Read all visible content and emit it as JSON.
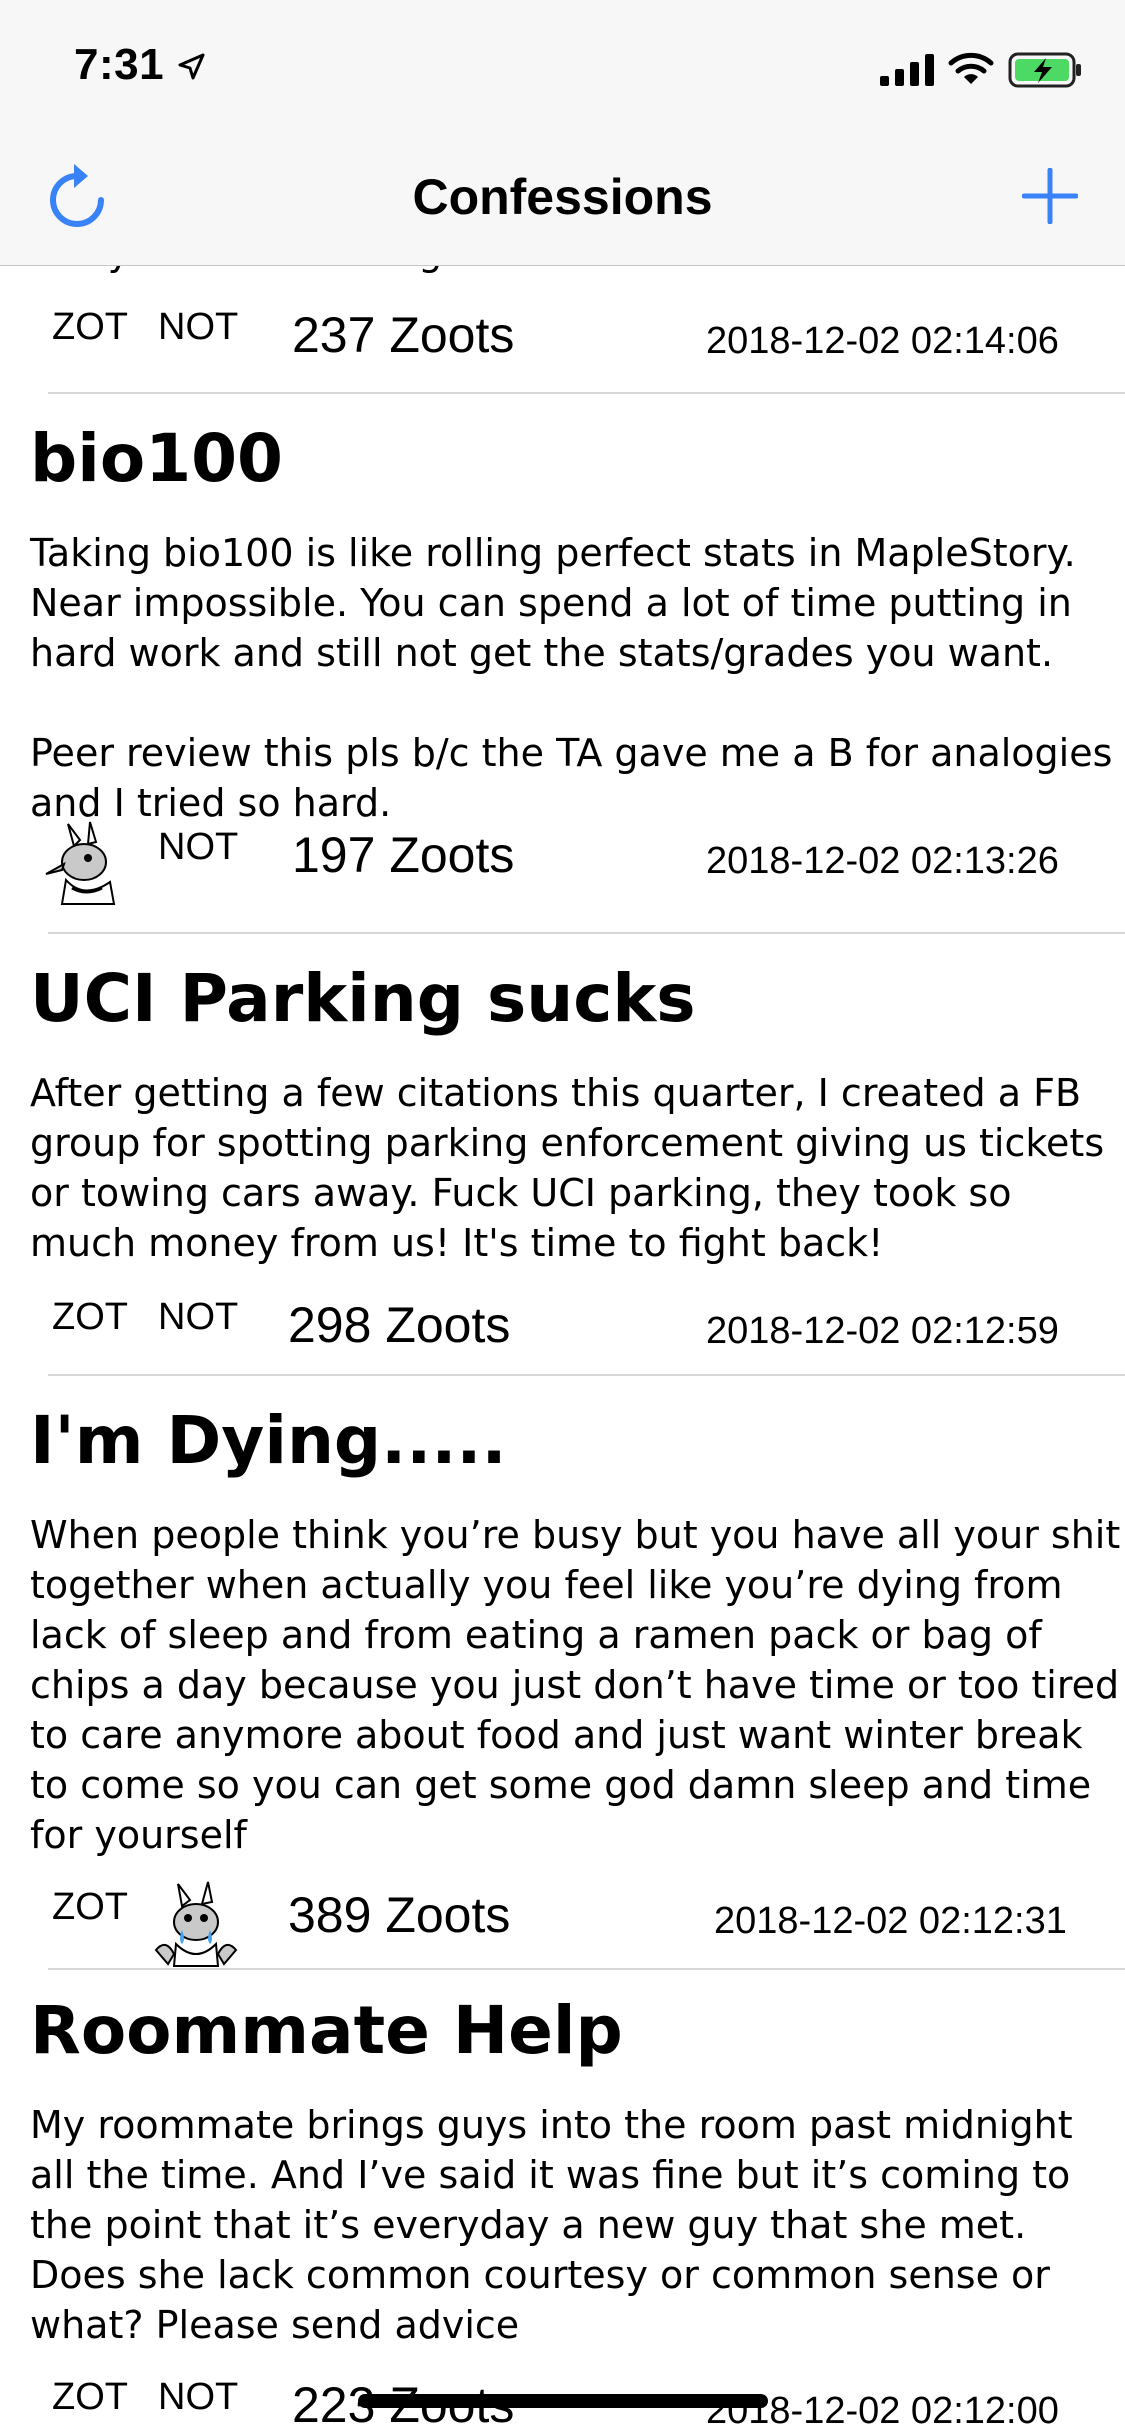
{
  "status_bar": {
    "time": "7:31"
  },
  "nav": {
    "title": "Confessions",
    "refresh_icon": "refresh-icon",
    "add_icon": "plus-icon",
    "accent": "#3a82f7"
  },
  "clipped_text": "away until the feelings fade.",
  "posts": [
    {
      "zot_label": "ZOT",
      "not_label": "NOT",
      "zoots": "237 Zoots",
      "timestamp": "2018-12-02 02:14:06"
    },
    {
      "title": "bio100",
      "body": "Taking bio100 is like rolling perfect stats in MapleStory. Near impossible. You can spend a lot of time putting in hard work and still not get the stats/grades you want.\n\nPeer review this pls b/c the TA gave me a B for analogies and I tried so hard.",
      "not_label": "NOT",
      "zoots": "197 Zoots",
      "timestamp": "2018-12-02 02:13:26"
    },
    {
      "title": "UCI Parking sucks",
      "body": "After getting a few citations this quarter, I created a FB group for spotting parking enforcement giving us tickets or towing cars away. Fuck UCI parking, they took so much money from us! It's time to fight back!",
      "zot_label": "ZOT",
      "not_label": "NOT",
      "zoots": "298 Zoots",
      "timestamp": "2018-12-02 02:12:59"
    },
    {
      "title": "I'm Dying.....",
      "body": "When people think you’re busy but you have all your shit together when actually you feel like you’re dying from lack of sleep and from eating a ramen pack or bag of chips a day because you just don’t have time or too tired to care anymore about food and just want winter break to come so you can get some god damn sleep and time for yourself",
      "zot_label": "ZOT",
      "zoots": "389 Zoots",
      "timestamp": "2018-12-02 02:12:31"
    },
    {
      "title": "Roommate Help",
      "body": "My roommate brings guys into the room past midnight all the time. And I’ve said it was fine but it’s coming to the point that it’s everyday a new guy that she met. Does she lack common courtesy or common sense or what? Please send advice",
      "zot_label": "ZOT",
      "not_label": "NOT",
      "zoots": "223 Zoots",
      "timestamp": "2018-12-02 02:12:00"
    }
  ]
}
